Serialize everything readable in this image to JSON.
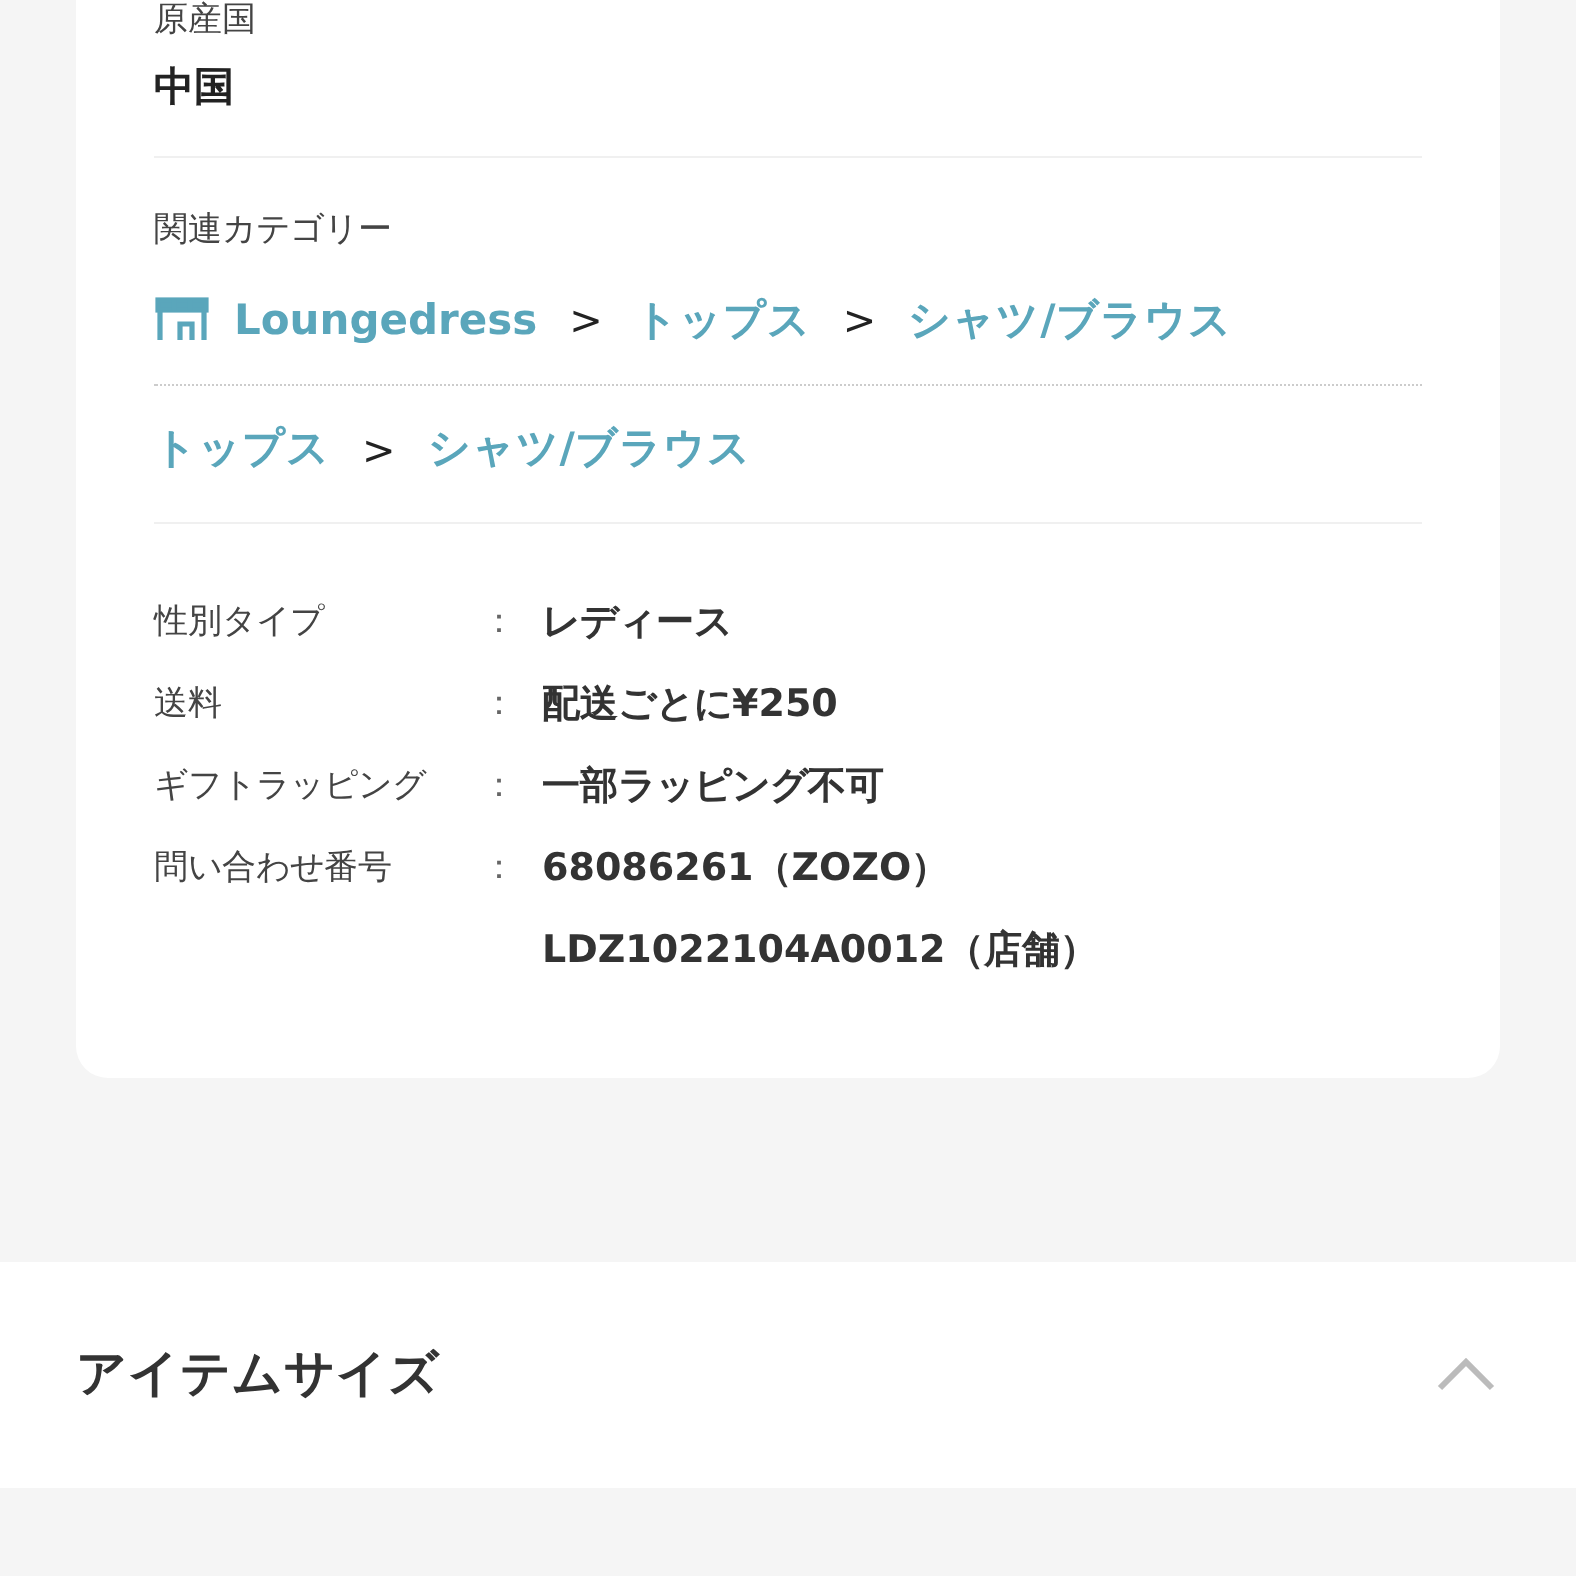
{
  "origin": {
    "label": "原産国",
    "value": "中国"
  },
  "related_category": {
    "label": "関連カテゴリー",
    "paths": [
      {
        "kind": "shop",
        "items": [
          "Loungedress",
          "トップス",
          "シャツ/ブラウス"
        ],
        "separator": ">"
      },
      {
        "kind": "plain",
        "items": [
          "トップス",
          "シャツ/ブラウス"
        ],
        "separator": ">"
      }
    ]
  },
  "details": [
    {
      "label": "性別タイプ",
      "values": [
        "レディース"
      ]
    },
    {
      "label": "送料",
      "values": [
        "配送ごとに¥250"
      ]
    },
    {
      "label": "ギフトラッピング",
      "values": [
        "一部ラッピング不可"
      ]
    },
    {
      "label": "問い合わせ番号",
      "values": [
        "68086261（ZOZO）",
        "LDZ1022104A0012（店舗）"
      ]
    }
  ],
  "details_separator": "：",
  "item_size": {
    "title": "アイテムサイズ",
    "expanded": true
  }
}
